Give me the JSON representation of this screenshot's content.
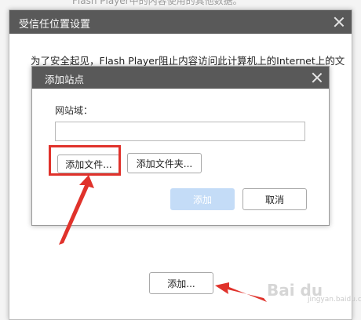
{
  "background_text": "Flash Player中的内容使用的其他数据。",
  "outer_dialog": {
    "title": "受信任位置设置",
    "description": "为了安全起见，Flash Player阻止内容访问此计算机上的Internet上的文",
    "add_button": "添加..."
  },
  "inner_dialog": {
    "title": "添加站点",
    "domain_label": "网站域：",
    "domain_value": "",
    "add_file_button": "添加文件...",
    "add_folder_button": "添加文件夹...",
    "confirm_button": "添加",
    "cancel_button": "取消"
  },
  "watermark": {
    "main": "Bai du",
    "sub": "jingyan.baidu.com"
  },
  "colors": {
    "titlebar": "#595959",
    "highlight": "#e0322b",
    "disabled_button": "#c4dcf7"
  }
}
